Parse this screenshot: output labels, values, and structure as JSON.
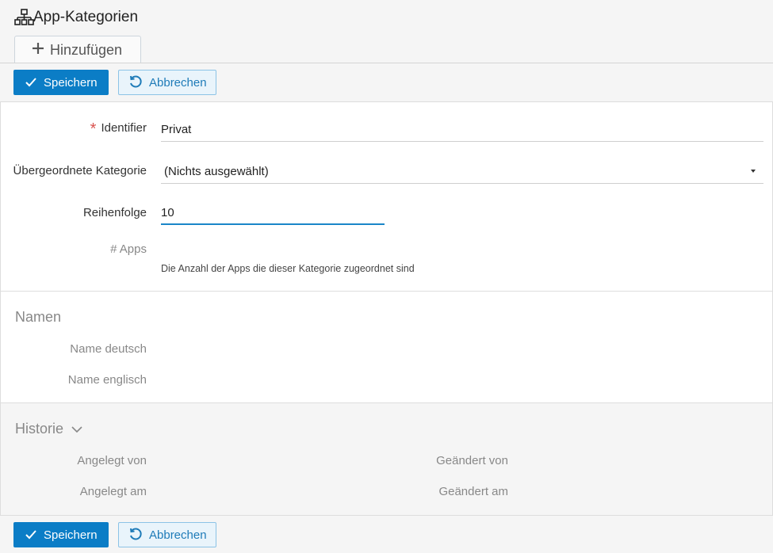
{
  "page": {
    "title": "App-Kategorien",
    "title_icon": "sitemap-icon"
  },
  "tabs": [
    {
      "label": "Hinzufügen",
      "icon": "plus-icon"
    }
  ],
  "toolbar": {
    "save_label": "Speichern",
    "cancel_label": "Abbrechen"
  },
  "form": {
    "identifier": {
      "label": "Identifier",
      "value": "Privat",
      "required": true
    },
    "parent_category": {
      "label": "Übergeordnete Kategorie",
      "value": "(Nichts ausgewählt)"
    },
    "order": {
      "label": "Reihenfolge",
      "value": "10"
    },
    "apps": {
      "label": "# Apps",
      "hint": "Die Anzahl der Apps die dieser Kategorie zugeordnet sind"
    }
  },
  "names": {
    "title": "Namen",
    "name_de_label": "Name deutsch",
    "name_en_label": "Name englisch"
  },
  "history": {
    "title": "Historie",
    "created_by_label": "Angelegt von",
    "created_at_label": "Angelegt am",
    "changed_by_label": "Geändert von",
    "changed_at_label": "Geändert am"
  },
  "colors": {
    "primary": "#0b7dc6",
    "secondary_bg": "#e9f4fb",
    "required": "#d9534f",
    "focus": "#1a86c8"
  }
}
